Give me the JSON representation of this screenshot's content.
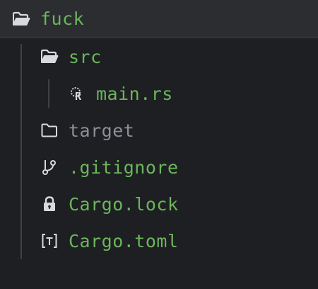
{
  "tree": {
    "root": {
      "label": "fuck",
      "icon": "folder-open-icon"
    },
    "items": [
      {
        "label": "src",
        "icon": "folder-open-icon"
      },
      {
        "label": "main.rs",
        "icon": "rust-file-icon"
      },
      {
        "label": "target",
        "icon": "folder-icon"
      },
      {
        "label": ".gitignore",
        "icon": "git-branch-icon"
      },
      {
        "label": "Cargo.lock",
        "icon": "lock-icon"
      },
      {
        "label": "Cargo.toml",
        "icon": "toml-file-icon"
      }
    ]
  },
  "colors": {
    "background": "#1e1f22",
    "root_row": "#2b2d31",
    "tracked_text": "#6bb65b",
    "ignored_text": "#8c8f96",
    "icon": "#d7d9de",
    "guide": "#3f4147"
  }
}
